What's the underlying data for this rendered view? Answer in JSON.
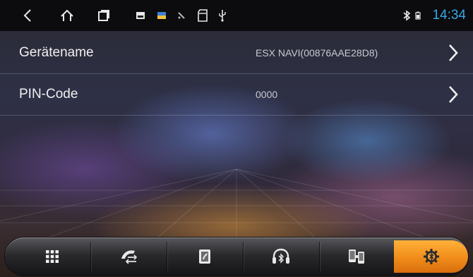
{
  "statusbar": {
    "clock": "14:34",
    "icons": [
      "back-icon",
      "home-icon",
      "recent-apps-icon",
      "image-icon",
      "photo-icon",
      "pen-icon",
      "sd-card-icon",
      "usb-icon"
    ],
    "status_icons": [
      "bluetooth-icon",
      "battery-icon"
    ],
    "clock_color": "#38a8e6"
  },
  "settings": {
    "rows": [
      {
        "label": "Gerätename",
        "value": "ESX NAVI(00876AAE28D8)"
      },
      {
        "label": "PIN-Code",
        "value": "0000"
      }
    ]
  },
  "dock": {
    "items": [
      "apps-grid-icon",
      "phone-calls-icon",
      "contacts-icon",
      "bluetooth-music-icon",
      "phone-link-icon",
      "bluetooth-settings-icon"
    ],
    "active_index": 5,
    "active_color": "#f59520"
  }
}
